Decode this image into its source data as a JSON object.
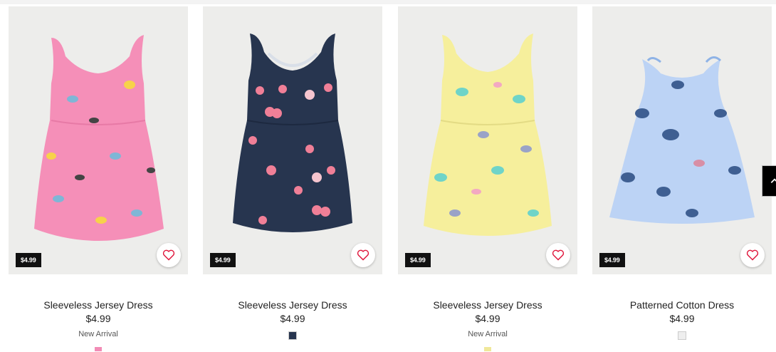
{
  "products": [
    {
      "title": "Sleeveless Jersey Dress",
      "price": "$4.99",
      "tag": "$4.99",
      "badge": "New Arrival",
      "color": "#f58fb8",
      "swatch": "#f28cb6",
      "print": "butterfly-print-pink"
    },
    {
      "title": "Sleeveless Jersey Dress",
      "price": "$4.99",
      "tag": "$4.99",
      "badge": "",
      "color": "#27354f",
      "swatch": "#27354f",
      "print": "cherry-print-navy"
    },
    {
      "title": "Sleeveless Jersey Dress",
      "price": "$4.99",
      "tag": "$4.99",
      "badge": "New Arrival",
      "color": "#f6ef9c",
      "swatch": "#f0e89a",
      "print": "butterfly-print-yellow"
    },
    {
      "title": "Patterned Cotton Dress",
      "price": "$4.99",
      "tag": "$4.99",
      "badge": "",
      "color": "#bcd3f5",
      "swatch": "#eeeeee",
      "print": "butterfly-print-lightblue"
    }
  ],
  "icons": {
    "favorite": "heart-icon",
    "scroll": "arrow-up-icon"
  },
  "colors": {
    "tag_bg": "#111111",
    "heart": "#e0183d",
    "image_bg": "#ededeb"
  }
}
